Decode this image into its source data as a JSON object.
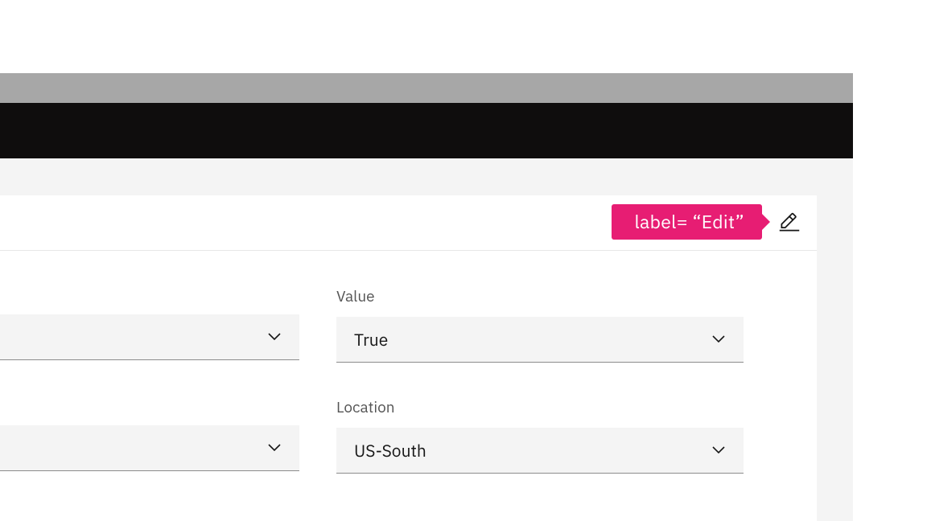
{
  "tooltip": {
    "text": "label= “Edit”"
  },
  "fields": {
    "value": {
      "label": "Value",
      "selected": "True"
    },
    "location": {
      "label": "Location",
      "selected": "US-South"
    }
  }
}
